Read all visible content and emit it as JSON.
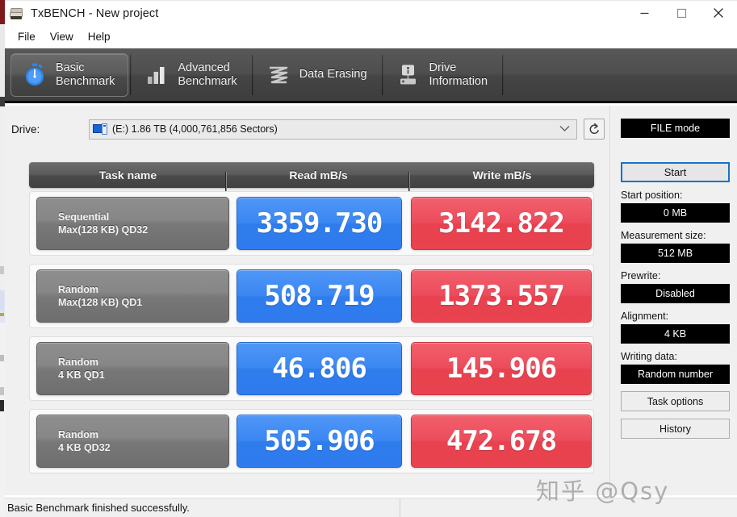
{
  "window": {
    "title": "TxBENCH - New project",
    "icon": "disk-drive-icon",
    "minimize": "–",
    "maximize": "☐",
    "close": "✕"
  },
  "menubar": {
    "items": [
      {
        "label": "File"
      },
      {
        "label": "View"
      },
      {
        "label": "Help"
      }
    ]
  },
  "tabs": [
    {
      "label": "Basic\nBenchmark",
      "icon": "stopwatch-icon",
      "active": true
    },
    {
      "label": "Advanced\nBenchmark",
      "icon": "bar-chart-icon",
      "active": false
    },
    {
      "label": "Data Erasing",
      "icon": "shredder-icon",
      "active": false
    },
    {
      "label": "Drive\nInformation",
      "icon": "drive-info-icon",
      "active": false
    }
  ],
  "drive": {
    "label": "Drive:",
    "icon": "drive-icon",
    "selected": "(E:)  1.86 TB (4,000,761,856 Sectors)",
    "dropdown_icon": "chevron-down-icon",
    "refresh_icon": "refresh-icon"
  },
  "table": {
    "headers": {
      "task": "Task name",
      "read": "Read mB/s",
      "write": "Write mB/s"
    }
  },
  "chart_data": {
    "type": "table",
    "title": "Basic Benchmark results",
    "columns": [
      "Task name",
      "Read mB/s",
      "Write mB/s"
    ],
    "rows": [
      {
        "task": "Sequential\nMax(128 KB) QD32",
        "read": "3359.730",
        "write": "3142.822",
        "read_value": 3359.73,
        "write_value": 3142.822
      },
      {
        "task": "Random\nMax(128 KB) QD1",
        "read": "508.719",
        "write": "1373.557",
        "read_value": 508.719,
        "write_value": 1373.557
      },
      {
        "task": "Random\n4 KB QD1",
        "read": "46.806",
        "write": "145.906",
        "read_value": 46.806,
        "write_value": 145.906
      },
      {
        "task": "Random\n4 KB QD32",
        "read": "505.906",
        "write": "472.678",
        "read_value": 505.906,
        "write_value": 472.678
      }
    ],
    "read_color": "#3b87f2",
    "write_color": "#ec4c5b"
  },
  "sidebar": {
    "mode": "FILE mode",
    "start_button": "Start",
    "fields": [
      {
        "label": "Start position:",
        "value": "0 MB"
      },
      {
        "label": "Measurement size:",
        "value": "512 MB"
      },
      {
        "label": "Prewrite:",
        "value": "Disabled"
      },
      {
        "label": "Alignment:",
        "value": "4 KB"
      },
      {
        "label": "Writing data:",
        "value": "Random number"
      }
    ],
    "task_options_button": "Task options",
    "history_button": "History"
  },
  "statusbar": {
    "message": "Basic Benchmark finished successfully."
  },
  "watermark": {
    "text": "知乎 @Qsy"
  },
  "colors": {
    "accent_blue": "#3b87f2",
    "accent_red": "#ec4c5b",
    "tab_dark": "#4e4e4e",
    "focus_blue": "#1773c8",
    "panel_bg": "#f0f0f0"
  }
}
